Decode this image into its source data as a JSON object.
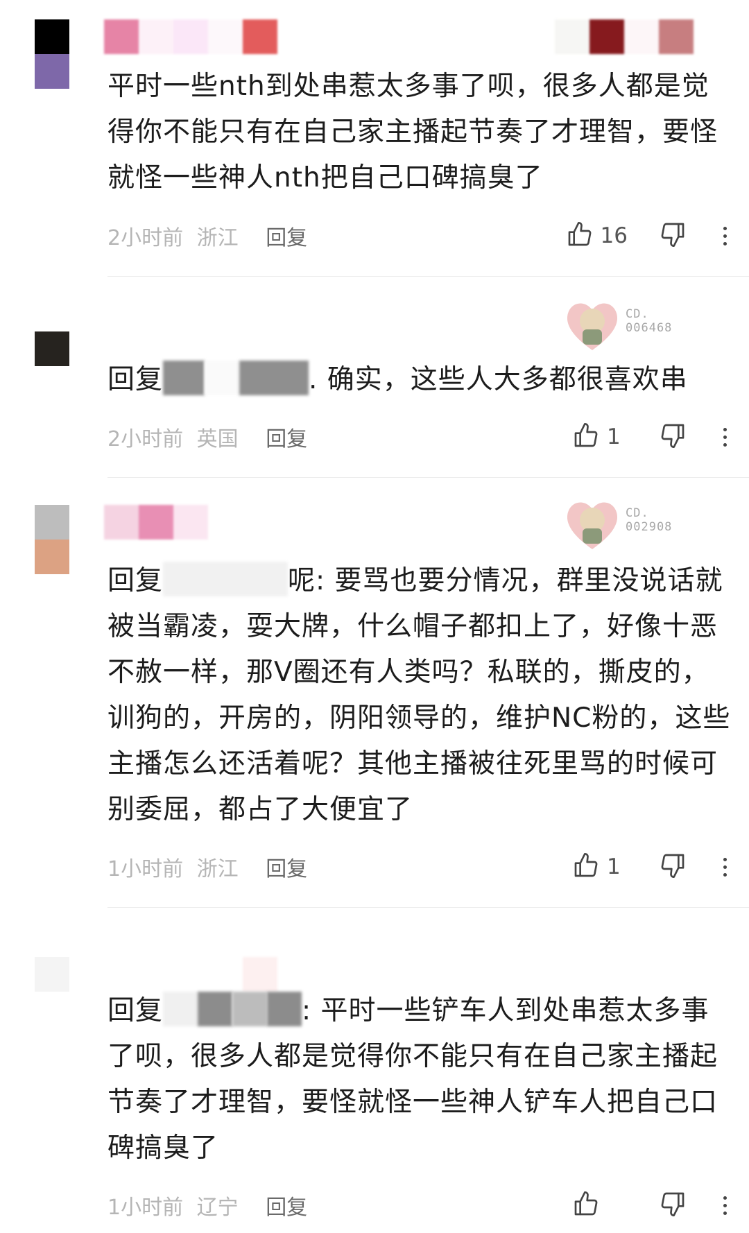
{
  "comments": [
    {
      "text": "平时一些nth到处串惹太多事了呗，很多人都是觉得你不能只有在自己家主播起节奏了才理智，要怪就怪一些神人nth把自己口碑搞臭了",
      "time": "2小时前",
      "location": "浙江",
      "reply_label": "回复",
      "likes": "16"
    },
    {
      "reply_prefix": "回复",
      "text": ". 确实，这些人大多都很喜欢串",
      "time": "2小时前",
      "location": "英国",
      "reply_label": "回复",
      "likes": "1",
      "badge_code_1": "CD.",
      "badge_code_2": "006468"
    },
    {
      "reply_prefix": "回复",
      "text": "呢: 要骂也要分情况，群里没说话就被当霸凌，耍大牌，什么帽子都扣上了，好像十恶不赦一样，那V圈还有人类吗？私联的，撕皮的，训狗的，开房的，阴阳领导的，维护NC粉的，这些主播怎么还活着呢？其他主播被往死里骂的时候可别委屈，都占了大便宜了",
      "time": "1小时前",
      "location": "浙江",
      "reply_label": "回复",
      "likes": "1",
      "badge_code_1": "CD.",
      "badge_code_2": "002908"
    },
    {
      "reply_prefix": "回复",
      "text": ": 平时一些铲车人到处串惹太多事了呗，很多人都是觉得你不能只有在自己家主播起节奏了才理智，要怪就怪一些神人铲车人把自己口碑搞臭了",
      "time": "1小时前",
      "location": "辽宁",
      "reply_label": "回复",
      "likes": ""
    }
  ],
  "icons": {
    "like": "thumbs-up-icon",
    "dislike": "thumbs-down-icon",
    "more": "more-vertical-icon",
    "badge": "fan-badge-icon"
  },
  "colors": {
    "text": "#1c1c1c",
    "meta": "#b5b5b5",
    "reply": "#6a6a6a",
    "divider": "#ececec"
  }
}
